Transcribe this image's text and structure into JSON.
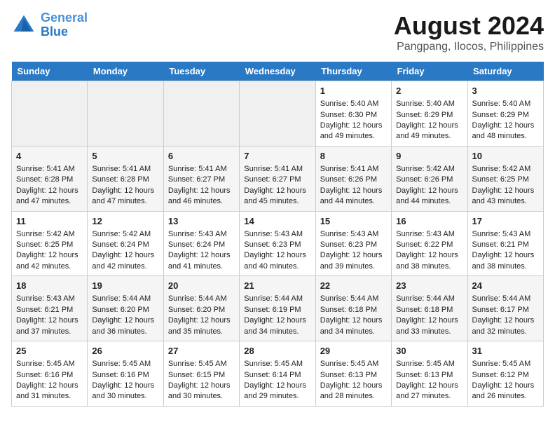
{
  "logo": {
    "line1": "General",
    "line2": "Blue"
  },
  "title": "August 2024",
  "subtitle": "Pangpang, Ilocos, Philippines",
  "days_header": [
    "Sunday",
    "Monday",
    "Tuesday",
    "Wednesday",
    "Thursday",
    "Friday",
    "Saturday"
  ],
  "weeks": [
    [
      {
        "day": "",
        "sunrise": "",
        "sunset": "",
        "daylight": ""
      },
      {
        "day": "",
        "sunrise": "",
        "sunset": "",
        "daylight": ""
      },
      {
        "day": "",
        "sunrise": "",
        "sunset": "",
        "daylight": ""
      },
      {
        "day": "",
        "sunrise": "",
        "sunset": "",
        "daylight": ""
      },
      {
        "day": "1",
        "sunrise": "Sunrise: 5:40 AM",
        "sunset": "Sunset: 6:30 PM",
        "daylight": "Daylight: 12 hours and 49 minutes."
      },
      {
        "day": "2",
        "sunrise": "Sunrise: 5:40 AM",
        "sunset": "Sunset: 6:29 PM",
        "daylight": "Daylight: 12 hours and 49 minutes."
      },
      {
        "day": "3",
        "sunrise": "Sunrise: 5:40 AM",
        "sunset": "Sunset: 6:29 PM",
        "daylight": "Daylight: 12 hours and 48 minutes."
      }
    ],
    [
      {
        "day": "4",
        "sunrise": "Sunrise: 5:41 AM",
        "sunset": "Sunset: 6:28 PM",
        "daylight": "Daylight: 12 hours and 47 minutes."
      },
      {
        "day": "5",
        "sunrise": "Sunrise: 5:41 AM",
        "sunset": "Sunset: 6:28 PM",
        "daylight": "Daylight: 12 hours and 47 minutes."
      },
      {
        "day": "6",
        "sunrise": "Sunrise: 5:41 AM",
        "sunset": "Sunset: 6:27 PM",
        "daylight": "Daylight: 12 hours and 46 minutes."
      },
      {
        "day": "7",
        "sunrise": "Sunrise: 5:41 AM",
        "sunset": "Sunset: 6:27 PM",
        "daylight": "Daylight: 12 hours and 45 minutes."
      },
      {
        "day": "8",
        "sunrise": "Sunrise: 5:41 AM",
        "sunset": "Sunset: 6:26 PM",
        "daylight": "Daylight: 12 hours and 44 minutes."
      },
      {
        "day": "9",
        "sunrise": "Sunrise: 5:42 AM",
        "sunset": "Sunset: 6:26 PM",
        "daylight": "Daylight: 12 hours and 44 minutes."
      },
      {
        "day": "10",
        "sunrise": "Sunrise: 5:42 AM",
        "sunset": "Sunset: 6:25 PM",
        "daylight": "Daylight: 12 hours and 43 minutes."
      }
    ],
    [
      {
        "day": "11",
        "sunrise": "Sunrise: 5:42 AM",
        "sunset": "Sunset: 6:25 PM",
        "daylight": "Daylight: 12 hours and 42 minutes."
      },
      {
        "day": "12",
        "sunrise": "Sunrise: 5:42 AM",
        "sunset": "Sunset: 6:24 PM",
        "daylight": "Daylight: 12 hours and 42 minutes."
      },
      {
        "day": "13",
        "sunrise": "Sunrise: 5:43 AM",
        "sunset": "Sunset: 6:24 PM",
        "daylight": "Daylight: 12 hours and 41 minutes."
      },
      {
        "day": "14",
        "sunrise": "Sunrise: 5:43 AM",
        "sunset": "Sunset: 6:23 PM",
        "daylight": "Daylight: 12 hours and 40 minutes."
      },
      {
        "day": "15",
        "sunrise": "Sunrise: 5:43 AM",
        "sunset": "Sunset: 6:23 PM",
        "daylight": "Daylight: 12 hours and 39 minutes."
      },
      {
        "day": "16",
        "sunrise": "Sunrise: 5:43 AM",
        "sunset": "Sunset: 6:22 PM",
        "daylight": "Daylight: 12 hours and 38 minutes."
      },
      {
        "day": "17",
        "sunrise": "Sunrise: 5:43 AM",
        "sunset": "Sunset: 6:21 PM",
        "daylight": "Daylight: 12 hours and 38 minutes."
      }
    ],
    [
      {
        "day": "18",
        "sunrise": "Sunrise: 5:43 AM",
        "sunset": "Sunset: 6:21 PM",
        "daylight": "Daylight: 12 hours and 37 minutes."
      },
      {
        "day": "19",
        "sunrise": "Sunrise: 5:44 AM",
        "sunset": "Sunset: 6:20 PM",
        "daylight": "Daylight: 12 hours and 36 minutes."
      },
      {
        "day": "20",
        "sunrise": "Sunrise: 5:44 AM",
        "sunset": "Sunset: 6:20 PM",
        "daylight": "Daylight: 12 hours and 35 minutes."
      },
      {
        "day": "21",
        "sunrise": "Sunrise: 5:44 AM",
        "sunset": "Sunset: 6:19 PM",
        "daylight": "Daylight: 12 hours and 34 minutes."
      },
      {
        "day": "22",
        "sunrise": "Sunrise: 5:44 AM",
        "sunset": "Sunset: 6:18 PM",
        "daylight": "Daylight: 12 hours and 34 minutes."
      },
      {
        "day": "23",
        "sunrise": "Sunrise: 5:44 AM",
        "sunset": "Sunset: 6:18 PM",
        "daylight": "Daylight: 12 hours and 33 minutes."
      },
      {
        "day": "24",
        "sunrise": "Sunrise: 5:44 AM",
        "sunset": "Sunset: 6:17 PM",
        "daylight": "Daylight: 12 hours and 32 minutes."
      }
    ],
    [
      {
        "day": "25",
        "sunrise": "Sunrise: 5:45 AM",
        "sunset": "Sunset: 6:16 PM",
        "daylight": "Daylight: 12 hours and 31 minutes."
      },
      {
        "day": "26",
        "sunrise": "Sunrise: 5:45 AM",
        "sunset": "Sunset: 6:16 PM",
        "daylight": "Daylight: 12 hours and 30 minutes."
      },
      {
        "day": "27",
        "sunrise": "Sunrise: 5:45 AM",
        "sunset": "Sunset: 6:15 PM",
        "daylight": "Daylight: 12 hours and 30 minutes."
      },
      {
        "day": "28",
        "sunrise": "Sunrise: 5:45 AM",
        "sunset": "Sunset: 6:14 PM",
        "daylight": "Daylight: 12 hours and 29 minutes."
      },
      {
        "day": "29",
        "sunrise": "Sunrise: 5:45 AM",
        "sunset": "Sunset: 6:13 PM",
        "daylight": "Daylight: 12 hours and 28 minutes."
      },
      {
        "day": "30",
        "sunrise": "Sunrise: 5:45 AM",
        "sunset": "Sunset: 6:13 PM",
        "daylight": "Daylight: 12 hours and 27 minutes."
      },
      {
        "day": "31",
        "sunrise": "Sunrise: 5:45 AM",
        "sunset": "Sunset: 6:12 PM",
        "daylight": "Daylight: 12 hours and 26 minutes."
      }
    ]
  ]
}
